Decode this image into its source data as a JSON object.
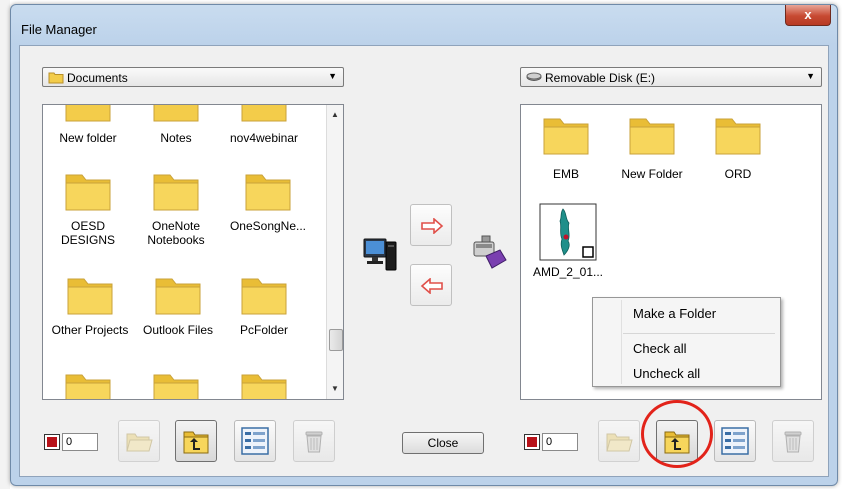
{
  "window": {
    "title": "File Manager",
    "close_glyph": "x"
  },
  "left_pane": {
    "location": "Documents",
    "location_icon": "folder-icon",
    "items": [
      {
        "label": "New folder"
      },
      {
        "label": "Notes"
      },
      {
        "label": "nov4webinar"
      },
      {
        "label": "OESD DESIGNS"
      },
      {
        "label": "OneNote Notebooks"
      },
      {
        "label": "OneSongNe..."
      },
      {
        "label": "Other Projects"
      },
      {
        "label": "Outlook Files"
      },
      {
        "label": "PcFolder"
      }
    ],
    "checked_count": "0"
  },
  "right_pane": {
    "location": "Removable Disk (E:)",
    "location_icon": "drive-icon",
    "items": [
      {
        "label": "EMB"
      },
      {
        "label": "New Folder"
      },
      {
        "label": "ORD"
      },
      {
        "label": "AMD_2_01..."
      }
    ],
    "checked_count": "0"
  },
  "context_menu": {
    "items": [
      {
        "label": "Make a Folder"
      },
      {
        "label": "Check all"
      },
      {
        "label": "Uncheck all"
      }
    ]
  },
  "buttons": {
    "close_label": "Close"
  },
  "colors": {
    "folder": "#f3cc4a",
    "accent_red": "#e2231a",
    "arrow_red": "#e0504a"
  }
}
